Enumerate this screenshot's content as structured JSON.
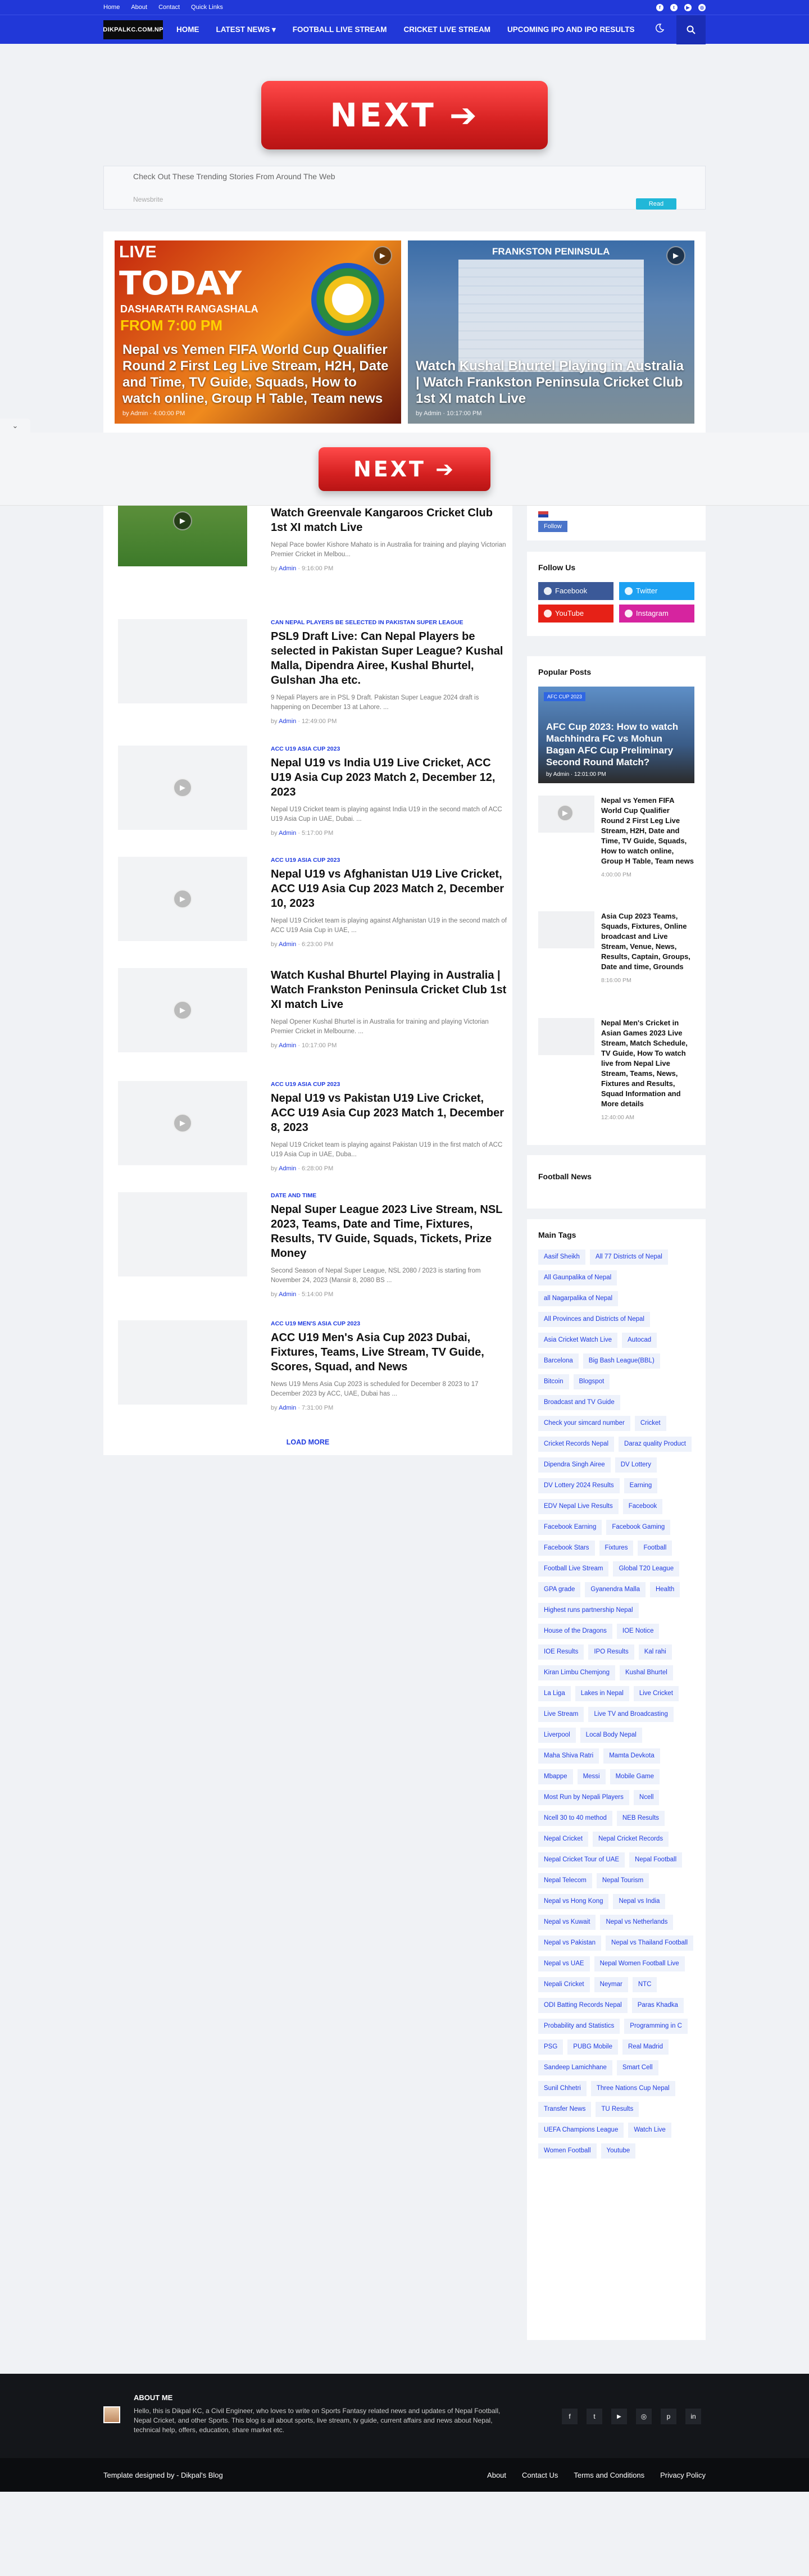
{
  "topbar": {
    "links": [
      "Home",
      "About",
      "Contact",
      "Quick Links"
    ],
    "social_icons": [
      "facebook-icon",
      "twitter-icon",
      "youtube-icon",
      "instagram-icon"
    ]
  },
  "nav": {
    "logo": "DIKPALKC.COM.NP",
    "menu": [
      "HOME",
      "LATEST NEWS ▾",
      "FOOTBALL LIVE STREAM",
      "CRICKET LIVE STREAM",
      "UPCOMING IPO AND IPO RESULTS"
    ]
  },
  "ad": {
    "next_label": "NEXT ➔"
  },
  "trending": {
    "heading": "Check Out These Trending Stories From Around The Web",
    "sub": "Newsbrite",
    "read": "Read"
  },
  "hero": [
    {
      "thumb_text": [
        "LIVE",
        "TODAY",
        "DASHARATH RANGASHALA",
        "FROM 7:00 PM"
      ],
      "title": "Nepal vs Yemen FIFA World Cup Qualifier Round 2 First Leg Live Stream, H2H, Date and Time, TV Guide, Squads, How to watch online, Group H Table, Team news",
      "author": "Admin",
      "time": "4:00:00 PM"
    },
    {
      "thumb_text": [
        "FRANKSTON PENINSULA"
      ],
      "title": "Watch Kushal Bhurtel Playing in Australia | Watch Frankston Peninsula Cricket Club 1st XI match Live",
      "author": "Admin",
      "time": "10:17:00 PM"
    }
  ],
  "posts": [
    {
      "cat": "",
      "title": "Watch Greenvale Kangaroos Cricket Club 1st XI match Live",
      "excerpt": "Nepal Pace bowler Kishore Mahato is in Australia for training and playing Victorian Premier Cricket in Melbou...",
      "author": "Admin",
      "time": "9:16:00 PM",
      "video": true
    },
    {
      "cat": "CAN NEPAL PLAYERS BE SELECTED IN PAKISTAN SUPER LEAGUE",
      "title": "PSL9 Draft Live: Can Nepal Players be selected in Pakistan Super League? Kushal Malla, Dipendra Airee, Kushal Bhurtel, Gulshan Jha etc.",
      "excerpt": "9 Nepali Players are in PSL 9 Draft. Pakistan Super League 2024 draft is happening on December 13 at Lahore. ...",
      "author": "Admin",
      "time": "12:49:00 PM",
      "video": false
    },
    {
      "cat": "ACC U19 ASIA CUP 2023",
      "title": "Nepal U19 vs India U19 Live Cricket, ACC U19 Asia Cup 2023 Match 2, December 12, 2023",
      "excerpt": "Nepal U19 Cricket team is playing against India U19 in the second match of ACC U19 Asia Cup in UAE, Dubai. ...",
      "author": "Admin",
      "time": "5:17:00 PM",
      "video": true
    },
    {
      "cat": "ACC U19 ASIA CUP 2023",
      "title": "Nepal U19 vs Afghanistan U19 Live Cricket, ACC U19 Asia Cup 2023 Match 2, December 10, 2023",
      "excerpt": "Nepal U19 Cricket team is playing against Afghanistan U19 in the second match of ACC U19 Asia Cup in UAE, ...",
      "author": "Admin",
      "time": "6:23:00 PM",
      "video": true
    },
    {
      "cat": "",
      "title": "Watch Kushal Bhurtel Playing in Australia | Watch Frankston Peninsula Cricket Club 1st XI match Live",
      "excerpt": "Nepal Opener Kushal Bhurtel is in Australia for training and playing Victorian Premier Cricket in Melbourne. ...",
      "author": "Admin",
      "time": "10:17:00 PM",
      "video": true
    },
    {
      "cat": "ACC U19 ASIA CUP 2023",
      "title": "Nepal U19 vs Pakistan U19 Live Cricket, ACC U19 Asia Cup 2023 Match 1, December 8, 2023",
      "excerpt": "Nepal U19 Cricket team is playing against Pakistan U19 in the first match of ACC U19 Asia Cup in UAE, Duba...",
      "author": "Admin",
      "time": "6:28:00 PM",
      "video": true
    },
    {
      "cat": "DATE AND TIME",
      "title": "Nepal Super League 2023 Live Stream, NSL 2023, Teams, Date and Time, Fixtures, Results, TV Guide, Squads, Tickets, Prize Money",
      "excerpt": "Second Season of Nepal Super League, NSL 2080 / 2023 is starting from November 24, 2023 (Mansir 8, 2080 BS ...",
      "author": "Admin",
      "time": "5:14:00 PM",
      "video": false
    },
    {
      "cat": "ACC U19 MEN'S ASIA CUP 2023",
      "title": "ACC U19 Men's Asia Cup 2023 Dubai, Fixtures, Teams, Live Stream, TV Guide, Scores, Squad, and News",
      "excerpt": "News U19 Mens Asia Cup 2023 is scheduled for December 8 2023 to 17 December 2023 by ACC, UAE, Dubai has ...",
      "author": "Admin",
      "time": "7:31:00 PM",
      "video": false
    }
  ],
  "load_more": "LOAD MORE",
  "sidebar": {
    "follow_btn": "Follow",
    "follow_us": "Follow Us",
    "social": [
      {
        "label": "Facebook",
        "color": "#3b5998"
      },
      {
        "label": "Twitter",
        "color": "#1da1f2"
      },
      {
        "label": "YouTube",
        "color": "#e62117"
      },
      {
        "label": "Instagram",
        "color": "#d6249f"
      }
    ],
    "popular_heading": "Popular Posts",
    "featured": {
      "cat": "AFC CUP 2023",
      "title": "AFC Cup 2023: How to watch Machhindra FC vs Mohun Bagan AFC Cup Preliminary Second Round Match?",
      "author": "Admin",
      "time": "12:01:00 PM"
    },
    "popular": [
      {
        "title": "Nepal vs Yemen FIFA World Cup Qualifier Round 2 First Leg Live Stream, H2H, Date and Time, TV Guide, Squads, How to watch online, Group H Table, Team news",
        "time": "4:00:00 PM"
      },
      {
        "title": "Asia Cup 2023 Teams, Squads, Fixtures, Online broadcast and Live Stream, Venue, News, Results, Captain, Groups, Date and time, Grounds",
        "time": "8:16:00 PM"
      },
      {
        "title": "Nepal Men's Cricket in Asian Games 2023 Live Stream, Match Schedule, TV Guide, How To watch live from Nepal Live Stream, Teams, News, Fixtures and Results, Squad Information and More details",
        "time": "12:40:00 AM"
      }
    ],
    "football_news": "Football News",
    "tags_heading": "Main Tags",
    "tags": [
      "Aasif Sheikh",
      "All 77 Districts of Nepal",
      "All Gaunpalika of Nepal",
      "all Nagarpalika of Nepal",
      "All Provinces and Districts of Nepal",
      "Asia Cricket Watch Live",
      "Autocad",
      "Barcelona",
      "Big Bash League(BBL)",
      "Bitcoin",
      "Blogspot",
      "Broadcast and TV Guide",
      "Check your simcard number",
      "Cricket",
      "Cricket Records Nepal",
      "Daraz quality Product",
      "Dipendra Singh Airee",
      "DV Lottery",
      "DV Lottery 2024 Results",
      "Earning",
      "EDV Nepal Live Results",
      "Facebook",
      "Facebook Earning",
      "Facebook Gaming",
      "Facebook Stars",
      "Fixtures",
      "Football",
      "Football Live Stream",
      "Global T20 League",
      "GPA grade",
      "Gyanendra Malla",
      "Health",
      "Highest runs partnership Nepal",
      "House of the Dragons",
      "IOE Notice",
      "IOE Results",
      "IPO Results",
      "Kal rahi",
      "Kiran Limbu Chemjong",
      "Kushal Bhurtel",
      "La Liga",
      "Lakes in Nepal",
      "Live Cricket",
      "Live Stream",
      "Live TV and Broadcasting",
      "Liverpool",
      "Local Body Nepal",
      "Maha Shiva Ratri",
      "Mamta Devkota",
      "Mbappe",
      "Messi",
      "Mobile Game",
      "Most Run by Nepali Players",
      "Ncell",
      "Ncell 30 to 40 method",
      "NEB Results",
      "Nepal Cricket",
      "Nepal Cricket Records",
      "Nepal Cricket Tour of UAE",
      "Nepal Football",
      "Nepal Telecom",
      "Nepal Tourism",
      "Nepal vs Hong Kong",
      "Nepal vs India",
      "Nepal vs Kuwait",
      "Nepal vs Netherlands",
      "Nepal vs Pakistan",
      "Nepal vs Thailand Football",
      "Nepal vs UAE",
      "Nepal Women Football Live",
      "Nepali Cricket",
      "Neymar",
      "NTC",
      "ODI Batting Records Nepal",
      "Paras Khadka",
      "Probability and Statistics",
      "Programming in C",
      "PSG",
      "PUBG Mobile",
      "Real Madrid",
      "Sandeep Lamichhane",
      "Smart Cell",
      "Sunil Chhetri",
      "Three Nations Cup Nepal",
      "Transfer News",
      "TU Results",
      "UEFA Champions League",
      "Watch Live",
      "Women Football",
      "Youtube"
    ]
  },
  "footer": {
    "about_heading": "ABOUT ME",
    "about_text": "Hello, this is Dikpal KC, a Civil Engineer, who loves to write on Sports Fantasy related news and updates of Nepal Football, Nepal Cricket, and other Sports. This blog is all about sports, live stream, tv guide, current affairs and news about Nepal, technical help, offers, education, share market etc.",
    "social_icons": [
      "facebook-icon",
      "twitter-icon",
      "youtube-icon",
      "instagram-icon",
      "pinterest-icon",
      "linkedin-icon"
    ],
    "credit": "Template designed by - Dikpal's Blog",
    "links": [
      "About",
      "Contact Us",
      "Terms and Conditions",
      "Privacy Policy"
    ]
  }
}
